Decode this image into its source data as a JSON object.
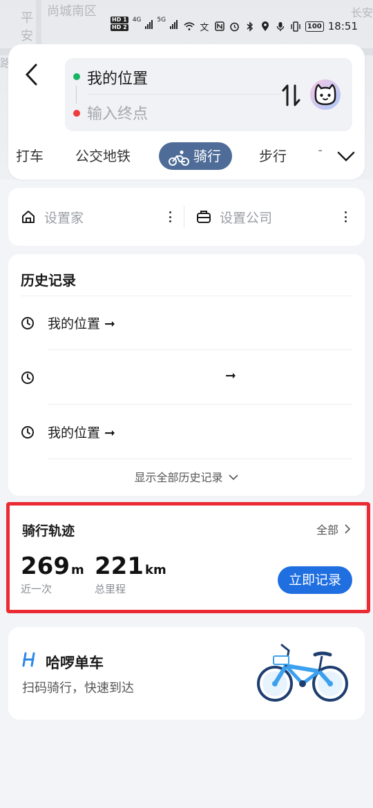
{
  "map": {
    "labels": [
      "平",
      "安",
      "尚城南区",
      "长安",
      "路"
    ]
  },
  "status_bar": {
    "hd_1": "HD 1",
    "hd_2": "HD 2",
    "net_1": "4G",
    "net_2": "5G",
    "battery": "100",
    "time": "18:51"
  },
  "route": {
    "from": "我的位置",
    "to_placeholder": "输入终点"
  },
  "tabs": [
    {
      "label": "打车"
    },
    {
      "label": "公交地铁"
    },
    {
      "label": "骑行",
      "active": true
    },
    {
      "label": "步行"
    },
    {
      "label": "飞"
    }
  ],
  "places": {
    "home_label": "设置家",
    "company_label": "设置公司"
  },
  "history": {
    "title": "历史记录",
    "items": [
      {
        "text": "我的位置",
        "arrow": "➞"
      },
      {
        "text": "",
        "arrow": "➞"
      },
      {
        "text": "我的位置",
        "arrow": "➞"
      }
    ],
    "show_all": "显示全部历史记录"
  },
  "track": {
    "title": "骑行轨迹",
    "all_label": "全部",
    "last": {
      "value": "269",
      "unit": "m",
      "caption": "近一次"
    },
    "total": {
      "value": "221",
      "unit": "km",
      "caption": "总里程"
    },
    "record_button": "立即记录"
  },
  "hellobike": {
    "title": "哈啰单车",
    "subtitle": "扫码骑行，快速到达"
  },
  "colors": {
    "active_tab": "#4e6c97",
    "record_button": "#1f6fe0",
    "highlight": "#eb2b33",
    "start_dot": "#19b464",
    "end_dot": "#f03c3c"
  }
}
